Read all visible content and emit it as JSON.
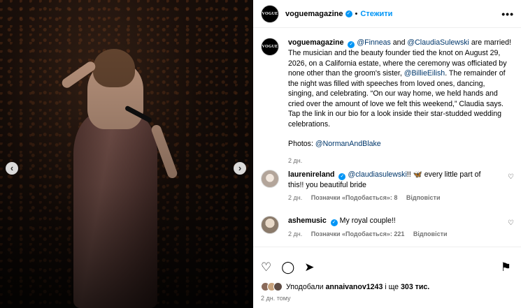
{
  "header": {
    "avatar_text": "VOGUE",
    "username": "voguemagazine",
    "follow_label": "Стежити",
    "separator": "•",
    "more_label": "•••"
  },
  "media": {
    "prev_label": "‹",
    "next_label": "›"
  },
  "caption": {
    "username": "voguemagazine",
    "mention1": "@Finneas",
    "and": " and ",
    "mention2": "@ClaudiaSulewski",
    "text1": " are married! The musician and the beauty founder tied the knot on August 29, 2026, on a California estate, where the ceremony was officiated by none other than the groom's sister, ",
    "mention3": "@BillieEilish",
    "text2": ". The remainder of the night was filled with speeches from loved ones, dancing, singing, and celebrating. “On our way home, we held hands and cried over the amount of love we felt this weekend,” Claudia says. Tap the link in our bio for a look inside their star-studded wedding celebrations.",
    "photos_label": "Photos: ",
    "photos_mention": "@NormanAndBlake",
    "time": "2 дн."
  },
  "comments": [
    {
      "username": "laurenireland",
      "mention": "@claudiasulewski",
      "text": "!! 🦋 every little part of this!! you beautiful bride",
      "time": "2 дн.",
      "likes": "Позначки «Подобається»: 8",
      "reply": "Відповісти"
    },
    {
      "username": "ashemusic",
      "text": "My royal couple!!",
      "time": "2 дн.",
      "likes": "Позначки «Подобається»: 221",
      "reply": "Відповісти"
    }
  ],
  "actions": {
    "like_icon": "♡",
    "comment_icon": "◯",
    "share_icon": "➤",
    "save_icon": "⚑",
    "likes_prefix": "Уподобали ",
    "likes_user": "annaivanov1243",
    "likes_suffix": " і ще ",
    "likes_count": "303 тис.",
    "time": "2 дн. тому"
  },
  "colors": {
    "accent": "#0095f6",
    "link": "#00376b",
    "muted": "#737373"
  }
}
